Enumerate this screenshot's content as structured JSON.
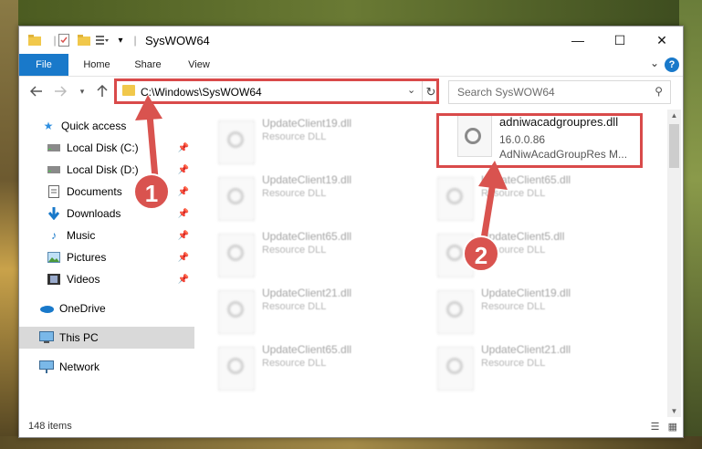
{
  "window": {
    "title": "SysWOW64",
    "controls": [
      "—",
      "☐",
      "✕"
    ]
  },
  "ribbon": {
    "tabs": [
      "File",
      "Home",
      "Share",
      "View"
    ],
    "help": "?"
  },
  "address": {
    "path": "C:\\Windows\\SysWOW64",
    "search_placeholder": "Search SysWOW64"
  },
  "sidebar": {
    "items": [
      {
        "label": "Quick access",
        "icon": "star-icon"
      },
      {
        "label": "Local Disk (C:)",
        "icon": "drive-icon",
        "pinned": true
      },
      {
        "label": "Local Disk (D:)",
        "icon": "drive-icon",
        "pinned": true
      },
      {
        "label": "Documents",
        "icon": "documents-icon",
        "pinned": true
      },
      {
        "label": "Downloads",
        "icon": "downloads-icon",
        "pinned": true
      },
      {
        "label": "Music",
        "icon": "music-icon",
        "pinned": true
      },
      {
        "label": "Pictures",
        "icon": "pictures-icon",
        "pinned": true
      },
      {
        "label": "Videos",
        "icon": "videos-icon",
        "pinned": true
      },
      {
        "label": "OneDrive",
        "icon": "cloud-icon"
      },
      {
        "label": "This PC",
        "icon": "computer-icon",
        "selected": true
      },
      {
        "label": "Network",
        "icon": "network-icon"
      }
    ]
  },
  "files": {
    "left": [
      {
        "name": "UpdateClient19.dll",
        "type": "Resource DLL"
      },
      {
        "name": "UpdateClient19.dll",
        "type": "Resource DLL"
      },
      {
        "name": "UpdateClient65.dll",
        "type": "Resource DLL"
      },
      {
        "name": "UpdateClient21.dll",
        "type": "Resource DLL"
      },
      {
        "name": "UpdateClient65.dll",
        "type": "Resource DLL"
      }
    ],
    "right": [
      {
        "name": "UpdateClient65.dll",
        "type": "Resource DLL"
      },
      {
        "name": "UpdateClient5.dll",
        "type": "Resource DLL"
      },
      {
        "name": "UpdateClient19.dll",
        "type": "Resource DLL"
      },
      {
        "name": "UpdateClient21.dll",
        "type": "Resource DLL"
      }
    ],
    "highlighted": {
      "name": "adniwacadgroupres.dll",
      "version": "16.0.0.86",
      "description": "AdNiwAcadGroupRes M..."
    }
  },
  "status": {
    "count": "148 items"
  },
  "annotations": [
    "1",
    "2"
  ],
  "colors": {
    "accent": "#1979ca",
    "highlight_red": "#d94a4a"
  }
}
